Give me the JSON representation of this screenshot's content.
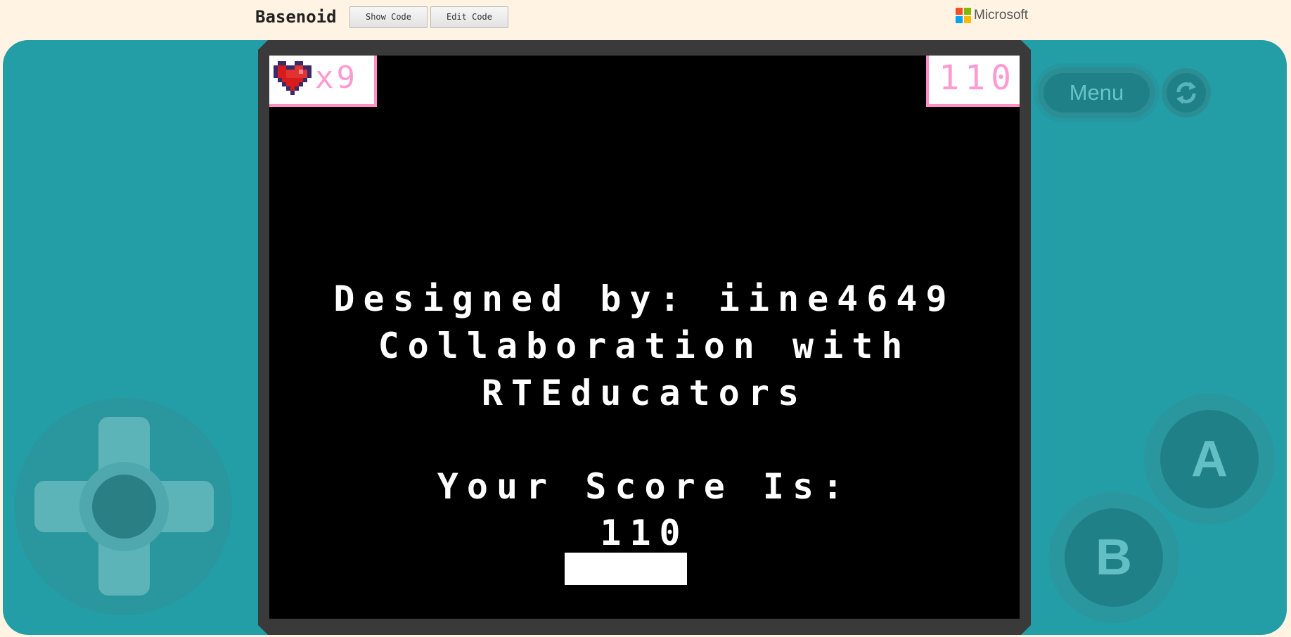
{
  "header": {
    "title": "Basenoid",
    "show_code_label": "Show Code",
    "edit_code_label": "Edit Code",
    "brand": "Microsoft",
    "brand_colors": [
      "#f25022",
      "#7fba00",
      "#00a4ef",
      "#ffb900"
    ]
  },
  "game": {
    "lives_text": "x9",
    "score_text": "110",
    "message_lines": [
      "Designed by: iine4649",
      "Collaboration with",
      "RTEducators",
      "Your Score Is:",
      "110"
    ],
    "accent_color": "#ff8fc6"
  },
  "controls": {
    "menu_label": "Menu",
    "a_label": "A",
    "b_label": "B",
    "console_color": "#239ea6"
  }
}
